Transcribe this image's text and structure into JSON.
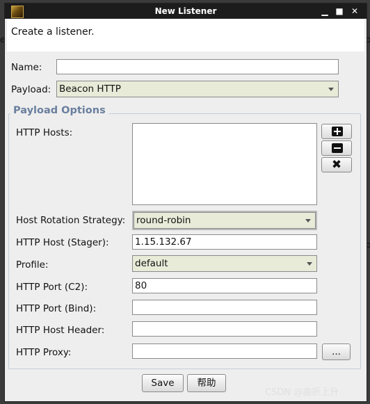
{
  "window": {
    "title": "New Listener",
    "minimize": "▁",
    "maximize": "■",
    "close": "✕"
  },
  "description": "Create a listener.",
  "form": {
    "name_label": "Name:",
    "name_value": "",
    "payload_label": "Payload:",
    "payload_value": "Beacon HTTP"
  },
  "payload_options": {
    "legend": "Payload Options",
    "http_hosts_label": "HTTP Hosts:",
    "http_hosts": [],
    "host_rotation_label": "Host Rotation Strategy:",
    "host_rotation_value": "round-robin",
    "stager_label": "HTTP Host (Stager):",
    "stager_value": "1.15.132.67",
    "profile_label": "Profile:",
    "profile_value": "default",
    "port_c2_label": "HTTP Port (C2):",
    "port_c2_value": "80",
    "port_bind_label": "HTTP Port (Bind):",
    "port_bind_value": "",
    "host_header_label": "HTTP Host Header:",
    "host_header_value": "",
    "proxy_label": "HTTP Proxy:",
    "proxy_value": "",
    "proxy_button": "..."
  },
  "buttons": {
    "save": "Save",
    "help": "帮助"
  },
  "background": {
    "left_fragment": "e",
    "right_fragment_1": "o",
    "right_fragment_2": "o"
  },
  "watermark": "CSDN @曲折上升",
  "icons": [
    "app-icon",
    "add-icon",
    "remove-icon",
    "clear-icon",
    "dropdown-arrow-icon"
  ]
}
